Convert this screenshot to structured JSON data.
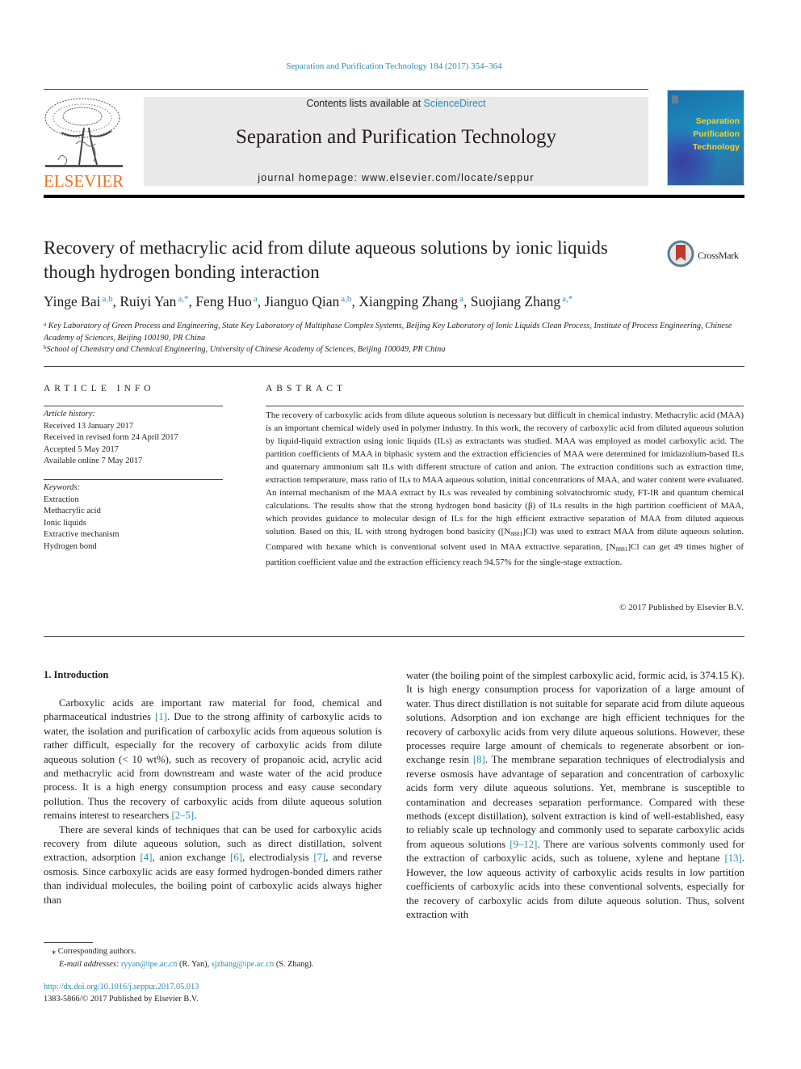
{
  "header": {
    "journal_reference": "Separation and Purification Technology 184 (2017) 354–364",
    "contents_prefix": "Contents lists available at ",
    "contents_link": "ScienceDirect",
    "journal_title": "Separation and Purification Technology",
    "homepage_label": "journal homepage: ",
    "homepage_url": "www.elsevier.com/locate/seppur",
    "publisher_wordmark": "ELSEVIER",
    "cover_title_lines": [
      "Separation",
      "Purification",
      "Technology"
    ],
    "crossmark_label": "CrossMark"
  },
  "colors": {
    "link": "#2a8cb4",
    "elsevier_orange": "#f26f21",
    "banner_bg": "#e9e9e9",
    "cover_title": "#f7d22a"
  },
  "article": {
    "title": "Recovery of methacrylic acid from dilute aqueous solutions by ionic liquids though hydrogen bonding interaction",
    "authors": [
      {
        "name": "Yinge Bai",
        "affil": "a,b"
      },
      {
        "name": "Ruiyi Yan",
        "affil": "a,*"
      },
      {
        "name": "Feng Huo",
        "affil": "a"
      },
      {
        "name": "Jianguo Qian",
        "affil": "a,b"
      },
      {
        "name": "Xiangping Zhang",
        "affil": "a"
      },
      {
        "name": "Suojiang Zhang",
        "affil": "a,*"
      }
    ],
    "affiliations": [
      {
        "key": "a",
        "text": "Key Laboratory of Green Process and Engineering, State Key Laboratory of Multiphase Complex Systems, Beijing Key Laboratory of Ionic Liquids Clean Process, Institute of Process Engineering, Chinese Academy of Sciences, Beijing 100190, PR China"
      },
      {
        "key": "b",
        "text": "School of Chemistry and Chemical Engineering, University of Chinese Academy of Sciences, Beijing 100049, PR China"
      }
    ]
  },
  "article_info": {
    "label": "ARTICLE INFO",
    "history_heading": "Article history:",
    "history": [
      "Received 13 January 2017",
      "Received in revised form 24 April 2017",
      "Accepted 5 May 2017",
      "Available online 7 May 2017"
    ],
    "keywords_heading": "Keywords:",
    "keywords": [
      "Extraction",
      "Methacrylic acid",
      "Ionic liquids",
      "Extractive mechanism",
      "Hydrogen bond"
    ]
  },
  "abstract": {
    "label": "ABSTRACT",
    "text_part1": "The recovery of carboxylic acids from dilute aqueous solution is necessary but difficult in chemical industry. Methacrylic acid (MAA) is an important chemical widely used in polymer industry. In this work, the recovery of carboxylic acid from diluted aqueous solution by liquid-liquid extraction using ionic liquids (ILs) as extractants was studied. MAA was employed as model carboxylic acid. The partition coefficients of MAA in biphasic system and the extraction efficiencies of MAA were determined for imidazolium-based ILs and quaternary ammonium salt ILs with different structure of cation and anion. The extraction conditions such as extraction time, extraction temperature, mass ratio of ILs to MAA aqueous solution, initial concentrations of MAA, and water content were evaluated. An internal mechanism of the MAA extract by ILs was revealed by combining solvatochromic study, FT-IR and quantum chemical calculations. The results show that the strong hydrogen bond basicity (β) of ILs results in the high partition coefficient of MAA, which provides guidance to molecular design of ILs for the high efficient extractive separation of MAA from diluted aqueous solution. Based on this, IL with strong hydrogen bond basicity ([N",
    "subscript": "8881",
    "text_part2": "]Cl) was used to extract MAA from dilute aqueous solution. Compared with hexane which is conventional solvent used in MAA extractive separation, [N",
    "text_part3": "]Cl can get 49 times higher of partition coefficient value and the extraction efficiency reach 94.57% for the single-stage extraction.",
    "copyright": "© 2017 Published by Elsevier B.V."
  },
  "introduction": {
    "heading": "1. Introduction",
    "left_p1": [
      {
        "t": "Carboxylic acids are important raw material for food, chemical and pharmaceutical industries "
      },
      {
        "ref": "[1]"
      },
      {
        "t": ". Due to the strong affinity of carboxylic acids to water, the isolation and purification of carboxylic acids from aqueous solution is rather difficult, especially for the recovery of carboxylic acids from dilute aqueous solution (< 10 wt%), such as recovery of propanoic acid, acrylic acid and methacrylic acid from downstream and waste water of the acid produce process. It is a high energy consumption process and easy cause secondary pollution. Thus the recovery of carboxylic acids from dilute aqueous solution remains interest to researchers "
      },
      {
        "ref": "[2–5]"
      },
      {
        "t": "."
      }
    ],
    "left_p2": [
      {
        "t": "There are several kinds of techniques that can be used for carboxylic acids recovery from dilute aqueous solution, such as direct distillation, solvent extraction, adsorption "
      },
      {
        "ref": "[4]"
      },
      {
        "t": ", anion exchange "
      },
      {
        "ref": "[6]"
      },
      {
        "t": ", electrodialysis "
      },
      {
        "ref": "[7]"
      },
      {
        "t": ", and reverse osmosis. Since carboxylic acids are easy formed hydrogen-bonded dimers rather than individual molecules, the boiling point of carboxylic acids always higher than"
      }
    ],
    "right_p1": [
      {
        "t": "water (the boiling point of the simplest carboxylic acid, formic acid, is 374.15 K). It is high energy consumption process for vaporization of a large amount of water. Thus direct distillation is not suitable for separate acid from dilute aqueous solutions. Adsorption and ion exchange are high efficient techniques for the recovery of carboxylic acids from very dilute aqueous solutions. However, these processes require large amount of chemicals to regenerate absorbent or ion-exchange resin "
      },
      {
        "ref": "[8]"
      },
      {
        "t": ". The membrane separation techniques of electrodialysis and reverse osmosis have advantage of separation and concentration of carboxylic acids form very dilute aqueous solutions. Yet, membrane is susceptible to contamination and decreases separation performance. Compared with these methods (except distillation), solvent extraction is kind of well-established, easy to reliably scale up technology and commonly used to separate carboxylic acids from aqueous solutions "
      },
      {
        "ref": "[9–12]"
      },
      {
        "t": ". There are various solvents commonly used for the extraction of carboxylic acids, such as toluene, xylene and heptane "
      },
      {
        "ref": "[13]"
      },
      {
        "t": ". However, the low aqueous activity of carboxylic acids results in low partition coefficients of carboxylic acids into these conventional solvents, especially for the recovery of carboxylic acids from dilute aqueous solution. Thus, solvent extraction with"
      }
    ]
  },
  "footnotes": {
    "corresponding_marker": "⁎",
    "corresponding_text": "Corresponding authors.",
    "email_label": "E-mail addresses:",
    "emails": [
      {
        "address": "ryyan@ipe.ac.cn",
        "name": "(R. Yan)"
      },
      {
        "address": "sjzhang@ipe.ac.cn",
        "name": "(S. Zhang)"
      }
    ],
    "doi": "http://dx.doi.org/10.1016/j.seppur.2017.05.013",
    "issn_line": "1383-5866/© 2017 Published by Elsevier B.V."
  }
}
